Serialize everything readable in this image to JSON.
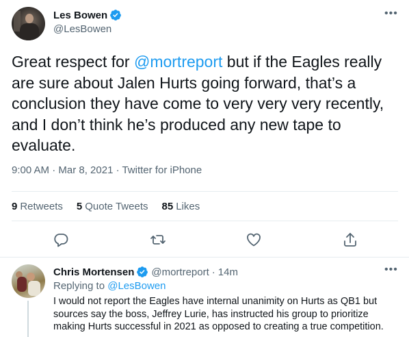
{
  "main_tweet": {
    "display_name": "Les Bowen",
    "handle": "@LesBowen",
    "text_prefix": "Great respect for ",
    "mention": "@mortreport",
    "text_suffix": " but if the Eagles really are sure about Jalen Hurts going forward, that’s a conclusion they have come to very very very recently, and I don’t think he’s produced any new tape to evaluate.",
    "timestamp": "9:00 AM · Mar 8, 2021 · Twitter for iPhone",
    "stats": {
      "retweets_count": "9",
      "retweets_label": "Retweets",
      "quotes_count": "5",
      "quotes_label": "Quote Tweets",
      "likes_count": "85",
      "likes_label": "Likes"
    },
    "more_icon": "more-horizontal-icon",
    "actions": [
      "reply-icon",
      "retweet-icon",
      "like-icon",
      "share-icon"
    ]
  },
  "reply_tweet": {
    "display_name": "Chris Mortensen",
    "handle": "@mortreport",
    "dot": "·",
    "time": "14m",
    "replying_prefix": "Replying to ",
    "replying_to": "@LesBowen",
    "text": "I would not report the Eagles have internal unanimity on Hurts as QB1 but sources say the boss, Jeffrey Lurie, has instructed his group to prioritize making Hurts successful in 2021 as opposed to creating a true competition."
  },
  "colors": {
    "accent": "#1d9bf0",
    "text_primary": "#0f1419",
    "text_secondary": "#536471",
    "divider": "#e6ecf0"
  }
}
